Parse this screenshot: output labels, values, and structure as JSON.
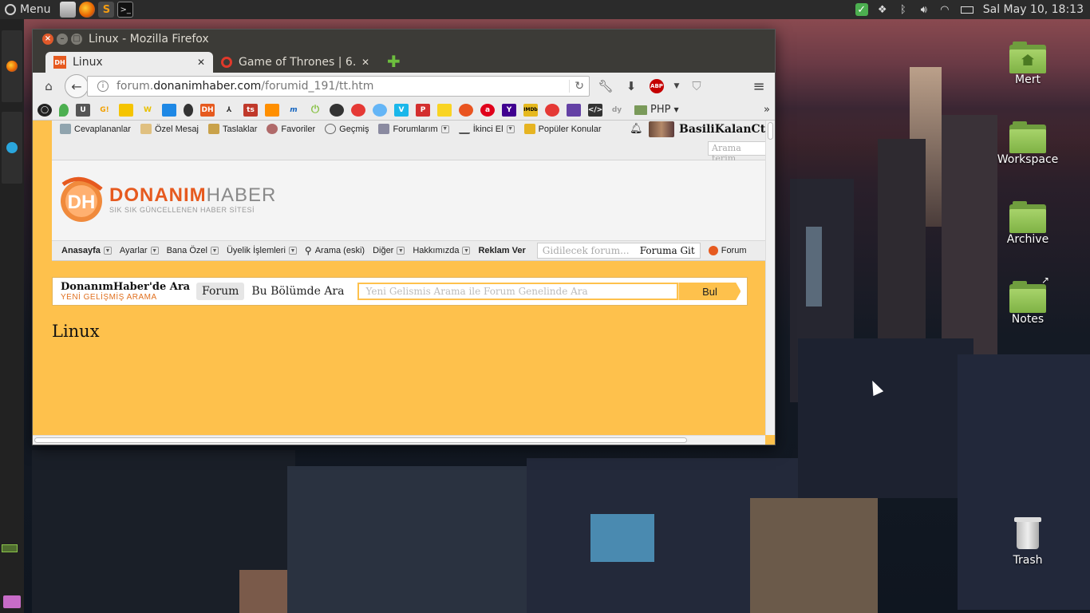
{
  "top_panel": {
    "menu_label": "Menu",
    "clock": "Sal May 10, 18:13"
  },
  "window": {
    "title": "Linux - Mozilla Firefox"
  },
  "tabs": [
    {
      "title": "Linux",
      "favicon": "DH"
    },
    {
      "title": "Game of Thrones | 6.…",
      "favicon": "opera-icon"
    }
  ],
  "url": {
    "prefix": "forum.",
    "host": "donanimhaber.com",
    "path": "/forumid_191/tt.htm"
  },
  "bookmarks": {
    "folder_label": "PHP",
    "items": [
      {
        "label": "G!",
        "color": "#f2a000"
      },
      {
        "label": "W",
        "color": "#e8c000"
      },
      {
        "label": "DH",
        "color": "#e65a1f"
      },
      {
        "label": "ts",
        "color": "#c0392b"
      },
      {
        "label": "a",
        "color": "#e0001b"
      },
      {
        "label": "Y",
        "color": "#400090"
      },
      {
        "label": "IMDb",
        "color": "#e6b91e"
      },
      {
        "label": "dy",
        "color": "#999999"
      }
    ]
  },
  "site": {
    "topnav": [
      {
        "label": "Cevaplananlar"
      },
      {
        "label": "Özel Mesaj"
      },
      {
        "label": "Taslaklar"
      },
      {
        "label": "Favoriler"
      },
      {
        "label": "Geçmiş"
      },
      {
        "label": "Forumlarım"
      },
      {
        "label": "İkinci El"
      },
      {
        "label": "Popüler Konular"
      }
    ],
    "username": "BasiliKalanCtrl",
    "mini_search_placeholder": "Arama terim",
    "logo": {
      "name_main": "DONANIM",
      "name_second": "HABER",
      "tagline": "SIK SIK GÜNCELLENEN HABER SİTESİ",
      "mark": "DH"
    },
    "menubar": {
      "items": [
        "Anasayfa",
        "Ayarlar",
        "Bana Özel",
        "Üyelik İşlemleri",
        "Arama (eski)",
        "Diğer",
        "Hakkımızda",
        "Reklam Ver"
      ],
      "goto_placeholder": "Gidilecek forum...",
      "goto_button": "Foruma Git",
      "forum_label": "Forum"
    },
    "search_panel": {
      "title": "DonanımHaber'de Ara",
      "subtitle": "YENİ GELİŞMİŞ ARAMA",
      "tab_forum": "Forum",
      "tab_section": "Bu Bölümde Ara",
      "placeholder": "Yeni Gelismis Arama ile Forum Genelinde Ara",
      "button": "Bul"
    },
    "section_heading": "Linux"
  },
  "desktop_icons": [
    {
      "label": "Mert"
    },
    {
      "label": "Workspace"
    },
    {
      "label": "Archive"
    },
    {
      "label": "Notes"
    },
    {
      "label": "Trash"
    }
  ],
  "colors": {
    "page_background": "#fec14c",
    "brand_orange": "#e65a1f",
    "folder_green": "#7fb245"
  }
}
